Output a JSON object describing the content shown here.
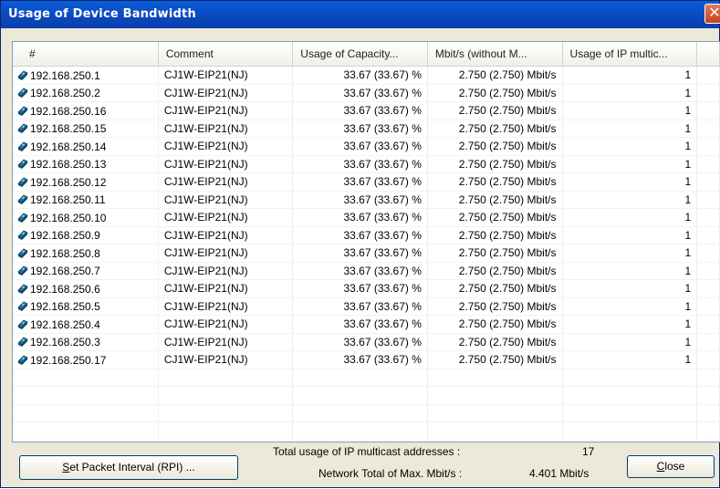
{
  "window": {
    "title": "Usage of Device Bandwidth",
    "close_glyph": "✕"
  },
  "table": {
    "columns": [
      "#",
      "Comment",
      "Usage of Capacity...",
      "Mbit/s (without M...",
      "Usage of IP multic..."
    ],
    "rows": [
      {
        "ip": "192.168.250.1",
        "comment": "CJ1W-EIP21(NJ)",
        "capacity": "33.67 (33.67) %",
        "mbit": "2.750 (2.750) Mbit/s",
        "multicast": "1"
      },
      {
        "ip": "192.168.250.2",
        "comment": "CJ1W-EIP21(NJ)",
        "capacity": "33.67 (33.67) %",
        "mbit": "2.750 (2.750) Mbit/s",
        "multicast": "1"
      },
      {
        "ip": "192.168.250.16",
        "comment": "CJ1W-EIP21(NJ)",
        "capacity": "33.67 (33.67) %",
        "mbit": "2.750 (2.750) Mbit/s",
        "multicast": "1"
      },
      {
        "ip": "192.168.250.15",
        "comment": "CJ1W-EIP21(NJ)",
        "capacity": "33.67 (33.67) %",
        "mbit": "2.750 (2.750) Mbit/s",
        "multicast": "1"
      },
      {
        "ip": "192.168.250.14",
        "comment": "CJ1W-EIP21(NJ)",
        "capacity": "33.67 (33.67) %",
        "mbit": "2.750 (2.750) Mbit/s",
        "multicast": "1"
      },
      {
        "ip": "192.168.250.13",
        "comment": "CJ1W-EIP21(NJ)",
        "capacity": "33.67 (33.67) %",
        "mbit": "2.750 (2.750) Mbit/s",
        "multicast": "1"
      },
      {
        "ip": "192.168.250.12",
        "comment": "CJ1W-EIP21(NJ)",
        "capacity": "33.67 (33.67) %",
        "mbit": "2.750 (2.750) Mbit/s",
        "multicast": "1"
      },
      {
        "ip": "192.168.250.11",
        "comment": "CJ1W-EIP21(NJ)",
        "capacity": "33.67 (33.67) %",
        "mbit": "2.750 (2.750) Mbit/s",
        "multicast": "1"
      },
      {
        "ip": "192.168.250.10",
        "comment": "CJ1W-EIP21(NJ)",
        "capacity": "33.67 (33.67) %",
        "mbit": "2.750 (2.750) Mbit/s",
        "multicast": "1"
      },
      {
        "ip": "192.168.250.9",
        "comment": "CJ1W-EIP21(NJ)",
        "capacity": "33.67 (33.67) %",
        "mbit": "2.750 (2.750) Mbit/s",
        "multicast": "1"
      },
      {
        "ip": "192.168.250.8",
        "comment": "CJ1W-EIP21(NJ)",
        "capacity": "33.67 (33.67) %",
        "mbit": "2.750 (2.750) Mbit/s",
        "multicast": "1"
      },
      {
        "ip": "192.168.250.7",
        "comment": "CJ1W-EIP21(NJ)",
        "capacity": "33.67 (33.67) %",
        "mbit": "2.750 (2.750) Mbit/s",
        "multicast": "1"
      },
      {
        "ip": "192.168.250.6",
        "comment": "CJ1W-EIP21(NJ)",
        "capacity": "33.67 (33.67) %",
        "mbit": "2.750 (2.750) Mbit/s",
        "multicast": "1"
      },
      {
        "ip": "192.168.250.5",
        "comment": "CJ1W-EIP21(NJ)",
        "capacity": "33.67 (33.67) %",
        "mbit": "2.750 (2.750) Mbit/s",
        "multicast": "1"
      },
      {
        "ip": "192.168.250.4",
        "comment": "CJ1W-EIP21(NJ)",
        "capacity": "33.67 (33.67) %",
        "mbit": "2.750 (2.750) Mbit/s",
        "multicast": "1"
      },
      {
        "ip": "192.168.250.3",
        "comment": "CJ1W-EIP21(NJ)",
        "capacity": "33.67 (33.67) %",
        "mbit": "2.750 (2.750) Mbit/s",
        "multicast": "1"
      },
      {
        "ip": "192.168.250.17",
        "comment": "CJ1W-EIP21(NJ)",
        "capacity": "33.67 (33.67) %",
        "mbit": "2.750 (2.750) Mbit/s",
        "multicast": "1"
      }
    ]
  },
  "footer": {
    "set_packet_button": {
      "underline": "S",
      "rest": "et Packet Interval (RPI) ..."
    },
    "multicast_label": "Total usage of IP multicast addresses :",
    "multicast_value": "17",
    "network_label": "Network Total of Max. Mbit/s :",
    "network_value": "4.401 Mbit/s",
    "close_button": {
      "underline": "C",
      "rest": "lose"
    }
  },
  "icons": {
    "device_icon": "device-node-icon"
  },
  "colors": {
    "titlebar": "#0a4fc8",
    "close": "#d4512d",
    "face": "#ece9d8"
  }
}
